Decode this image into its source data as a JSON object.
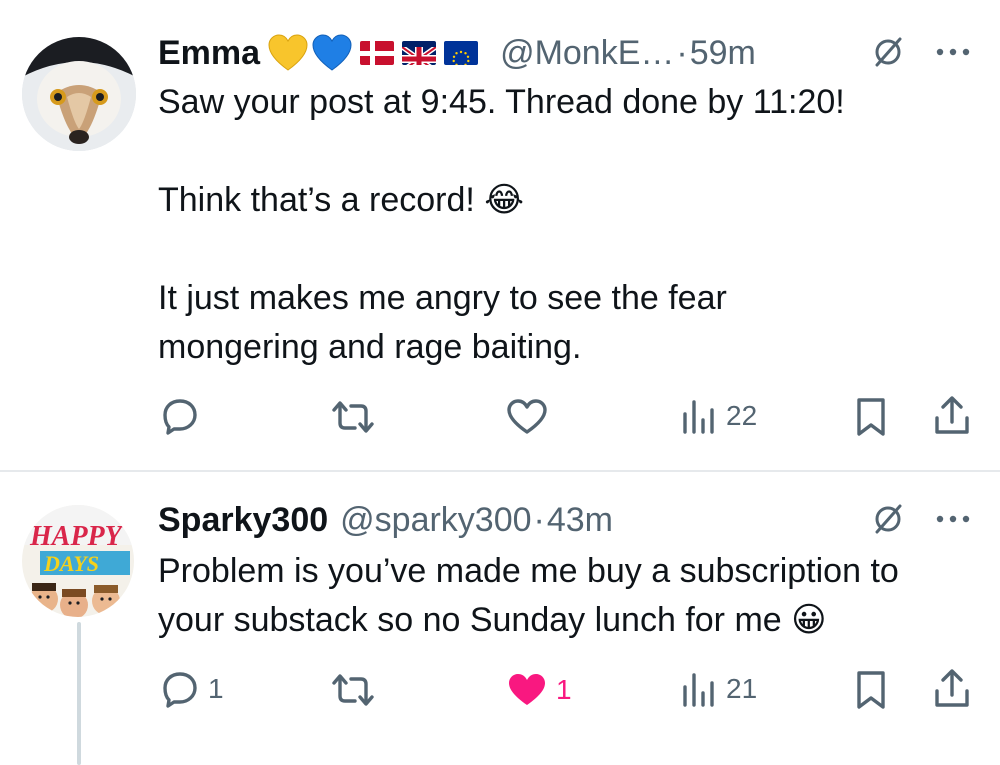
{
  "tweets": [
    {
      "name": "Emma",
      "handle": "@MonkE…",
      "separator": "·",
      "time": "59m",
      "paragraphs": [
        "Saw your post at 9:45. Thread done by 11:20!",
        "Think that’s a record! 😂",
        "It just makes me angry to see the fear mongering and rage baiting."
      ],
      "name_emojis": [
        "yellow-heart",
        "blue-heart"
      ],
      "name_flags": [
        "denmark-flag",
        "uk-flag",
        "eu-flag"
      ],
      "actions": {
        "reply_count": "",
        "retweet_count": "",
        "like_count": "",
        "views": "22"
      }
    },
    {
      "name": "Sparky300",
      "handle": "@sparky300",
      "separator": "·",
      "time": "43m",
      "paragraphs": [
        "Problem is you’ve made me buy a subscription to your substack so no Sunday lunch for me 😀"
      ],
      "avatar_text": [
        "HAPPY",
        "DAYS"
      ],
      "actions": {
        "reply_count": "1",
        "retweet_count": "",
        "like_count": "1",
        "views": "21"
      }
    }
  ],
  "colors": {
    "text": "#0f1419",
    "secondary": "#536471",
    "like_active": "#f91880",
    "divider": "#e6e9ec"
  }
}
